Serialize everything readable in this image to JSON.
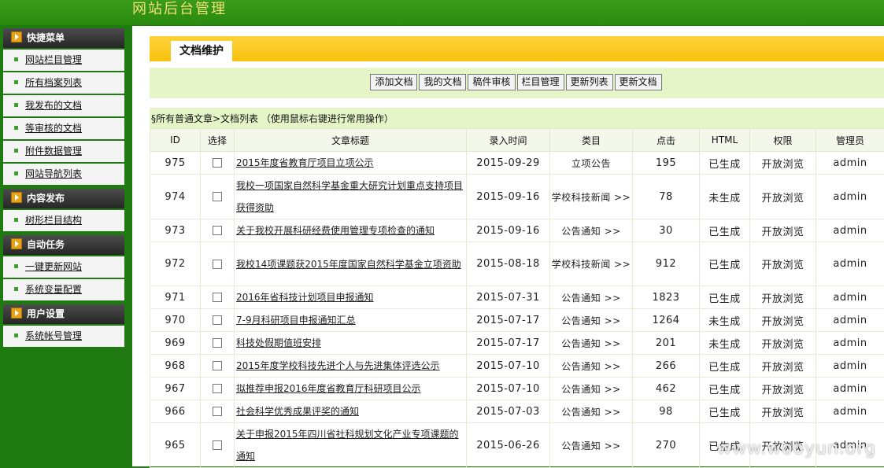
{
  "header": {
    "title": "网站后台管理"
  },
  "sidebar": {
    "groups": [
      {
        "title": "快捷菜单",
        "items": [
          "网站栏目管理",
          "所有档案列表",
          "我发布的文档",
          "等审核的文档",
          "附件数据管理",
          "网站导航列表"
        ]
      },
      {
        "title": "内容发布",
        "items": [
          "树形栏目结构"
        ]
      },
      {
        "title": "自动任务",
        "items": [
          "一键更新网站",
          "系统变量配置"
        ]
      },
      {
        "title": "用户设置",
        "items": [
          "系统帐号管理"
        ]
      }
    ]
  },
  "tab": {
    "label": "文档维护"
  },
  "toolbar": {
    "buttons": [
      "添加文档",
      "我的文档",
      "稿件审核",
      "栏目管理",
      "更新列表",
      "更新文档"
    ]
  },
  "breadcrumb": "§所有普通文章>文档列表 （使用鼠标右键进行常用操作）",
  "table": {
    "headers": [
      "ID",
      "选择",
      "文章标题",
      "录入时间",
      "类目",
      "点击",
      "HTML",
      "权限",
      "管理员"
    ],
    "rows": [
      {
        "id": "975",
        "title": "2015年度省教育厅项目立项公示",
        "date": "2015-09-29",
        "category": "立项公告",
        "clicks": "195",
        "html": "已生成",
        "perm": "开放浏览",
        "admin": "admin"
      },
      {
        "id": "974",
        "title": "我校一项国家自然科学基金重大研究计划重点支持项目获得资助",
        "date": "2015-09-16",
        "category": "学校科技新闻 >>",
        "clicks": "78",
        "html": "未生成",
        "perm": "开放浏览",
        "admin": "admin"
      },
      {
        "id": "973",
        "title": "关于我校开展科研经费使用管理专项检查的通知",
        "date": "2015-09-16",
        "category": "公告通知 >>",
        "clicks": "30",
        "html": "已生成",
        "perm": "开放浏览",
        "admin": "admin"
      },
      {
        "id": "972",
        "title": "我校14项课题获2015年度国家自然科学基金立项资助",
        "date": "2015-08-18",
        "category": "学校科技新闻 >>",
        "clicks": "912",
        "html": "已生成",
        "perm": "开放浏览",
        "admin": "admin"
      },
      {
        "id": "971",
        "title": "2016年省科技计划项目申报通知",
        "date": "2015-07-31",
        "category": "公告通知 >>",
        "clicks": "1823",
        "html": "已生成",
        "perm": "开放浏览",
        "admin": "admin"
      },
      {
        "id": "970",
        "title": "7-9月科研项目申报通知汇总",
        "date": "2015-07-17",
        "category": "公告通知 >>",
        "clicks": "1264",
        "html": "未生成",
        "perm": "开放浏览",
        "admin": "admin"
      },
      {
        "id": "969",
        "title": "科技处假期值班安排",
        "date": "2015-07-17",
        "category": "公告通知 >>",
        "clicks": "201",
        "html": "未生成",
        "perm": "开放浏览",
        "admin": "admin"
      },
      {
        "id": "968",
        "title": "2015年度学校科技先进个人与先进集体评选公示",
        "date": "2015-07-10",
        "category": "公告通知 >>",
        "clicks": "266",
        "html": "已生成",
        "perm": "开放浏览",
        "admin": "admin"
      },
      {
        "id": "967",
        "title": "拟推荐申报2016年度省教育厅科研项目公示",
        "date": "2015-07-10",
        "category": "公告通知 >>",
        "clicks": "462",
        "html": "已生成",
        "perm": "开放浏览",
        "admin": "admin"
      },
      {
        "id": "966",
        "title": "社会科学优秀成果评奖的通知",
        "date": "2015-07-03",
        "category": "公告通知 >>",
        "clicks": "98",
        "html": "已生成",
        "perm": "开放浏览",
        "admin": "admin"
      },
      {
        "id": "965",
        "title": "关于申报2015年四川省社科规划文化产业专项课题的通知",
        "date": "2015-06-26",
        "category": "公告通知 >>",
        "clicks": "270",
        "html": "已生成",
        "perm": "开放浏览",
        "admin": "admin"
      }
    ]
  },
  "watermark": "www.wooyun.org"
}
